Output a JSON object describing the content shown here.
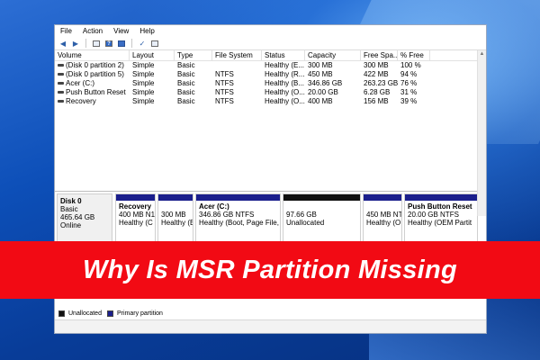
{
  "menu": [
    "File",
    "Action",
    "View",
    "Help"
  ],
  "icons": [
    "back-arrow-icon",
    "forward-arrow-icon",
    "list-view-icon",
    "help-icon",
    "properties-icon",
    "checklist-icon",
    "refresh-icon"
  ],
  "table": {
    "columns": [
      "Volume",
      "Layout",
      "Type",
      "File System",
      "Status",
      "Capacity",
      "Free Spa...",
      "% Free"
    ],
    "rows": [
      [
        "(Disk 0 partition 2)",
        "Simple",
        "Basic",
        "",
        "Healthy (E...",
        "300 MB",
        "300 MB",
        "100 %"
      ],
      [
        "(Disk 0 partition 5)",
        "Simple",
        "Basic",
        "NTFS",
        "Healthy (R...",
        "450 MB",
        "422 MB",
        "94 %"
      ],
      [
        "Acer (C:)",
        "Simple",
        "Basic",
        "NTFS",
        "Healthy (B...",
        "346.86 GB",
        "263.23 GB",
        "76 %"
      ],
      [
        "Push Button Reset",
        "Simple",
        "Basic",
        "NTFS",
        "Healthy (O...",
        "20.00 GB",
        "6.28 GB",
        "31 %"
      ],
      [
        "Recovery",
        "Simple",
        "Basic",
        "NTFS",
        "Healthy (O...",
        "400 MB",
        "156 MB",
        "39 %"
      ]
    ]
  },
  "disk": {
    "name": "Disk 0",
    "type": "Basic",
    "size": "465.64 GB",
    "status": "Online"
  },
  "partitions": [
    {
      "title": "Recovery",
      "line2": "400 MB N1",
      "line3": "Healthy (C",
      "unallocated": false
    },
    {
      "title": "",
      "line2": "300 MB",
      "line3": "Healthy (E",
      "unallocated": false
    },
    {
      "title": "Acer (C:)",
      "line2": "346.86 GB NTFS",
      "line3": "Healthy (Boot, Page File, C",
      "unallocated": false
    },
    {
      "title": "",
      "line2": "97.66 GB",
      "line3": "Unallocated",
      "unallocated": true
    },
    {
      "title": "",
      "line2": "450 MB NT",
      "line3": "Healthy (O",
      "unallocated": false
    },
    {
      "title": "Push Button Reset",
      "line2": "20.00 GB NTFS",
      "line3": "Healthy (OEM Partit",
      "unallocated": false
    }
  ],
  "legend": {
    "unallocated": "Unallocated",
    "primary": "Primary partition",
    "unallocated_color": "#111111",
    "primary_color": "#1b1f8c"
  },
  "banner": {
    "text": "Why Is MSR Partition Missing",
    "color": "#f20a14"
  }
}
